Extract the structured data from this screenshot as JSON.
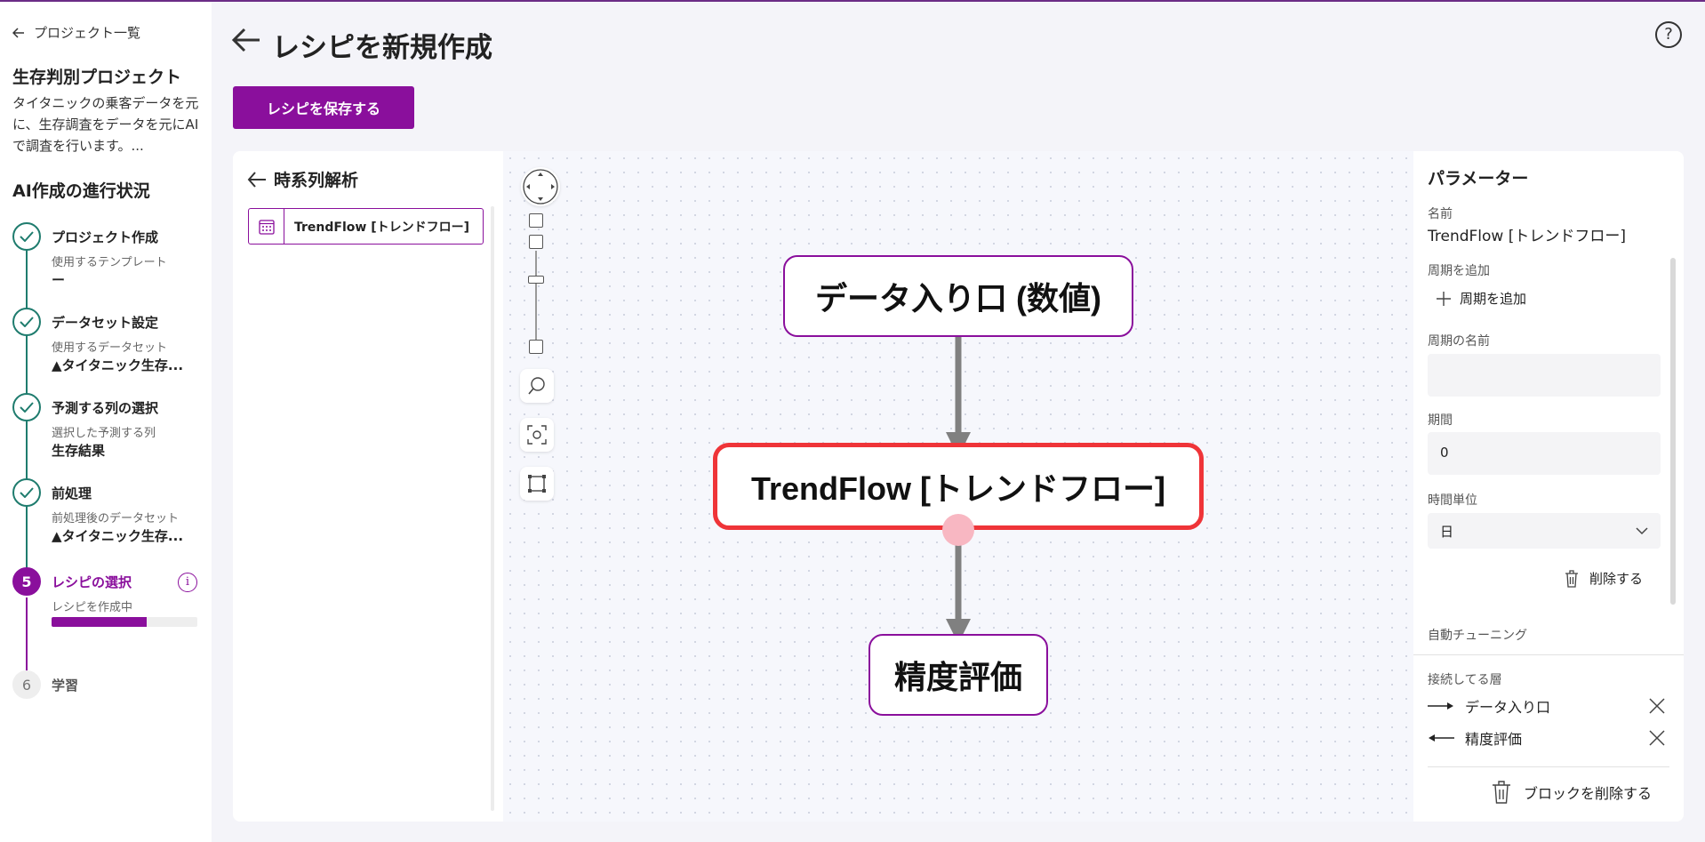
{
  "sidebar": {
    "back_label": "プロジェクト一覧",
    "project_title": "生存判別プロジェクト",
    "project_desc": "タイタニックの乗客データを元に、生存調査をデータを元にAIで調査を行います。...",
    "progress_title": "AI作成の進行状況",
    "steps": [
      {
        "name": "プロジェクト作成",
        "sub": "使用するテンプレート",
        "value": "ー",
        "status": "done"
      },
      {
        "name": "データセット設定",
        "sub": "使用するデータセット",
        "value": "▲タイタニック生存...",
        "status": "done"
      },
      {
        "name": "予測する列の選択",
        "sub": "選択した予測する列",
        "value": "生存結果",
        "status": "done"
      },
      {
        "name": "前処理",
        "sub": "前処理後のデータセット",
        "value": "▲タイタニック生存...",
        "status": "done"
      },
      {
        "num": "5",
        "name": "レシピの選択",
        "sub": "レシピを作成中",
        "status": "active",
        "progress": 0.65
      },
      {
        "num": "6",
        "name": "学習",
        "status": "todo"
      }
    ]
  },
  "header": {
    "title": "レシピを新規作成",
    "save_label": "レシピを保存する"
  },
  "block_list": {
    "category": "時系列解析",
    "items": [
      {
        "label": "TrendFlow [トレンドフロー]",
        "icon": "calendar-grid-icon"
      }
    ]
  },
  "canvas": {
    "nodes": [
      {
        "id": "input",
        "label": "データ入り口 (数値)"
      },
      {
        "id": "trendflow",
        "label": "TrendFlow [トレンドフロー]",
        "selected": true
      },
      {
        "id": "eval",
        "label": "精度評価"
      }
    ],
    "edges": [
      [
        "input",
        "trendflow"
      ],
      [
        "trendflow",
        "eval"
      ]
    ]
  },
  "params": {
    "title": "パラメーター",
    "name_label": "名前",
    "name_value": "TrendFlow [トレンドフロー]",
    "add_period_label": "周期を追加",
    "add_period_button": "周期を追加",
    "period_name_label": "周期の名前",
    "period_name_value": "",
    "duration_label": "期間",
    "duration_value": "0",
    "time_unit_label": "時間単位",
    "time_unit_value": "日",
    "delete_label": "削除する",
    "auto_tuning_label": "自動チューニング",
    "connected_label": "接続してる層",
    "connections": [
      {
        "direction": "out",
        "label": "データ入り口"
      },
      {
        "direction": "in",
        "label": "精度評価"
      }
    ],
    "delete_block_label": "ブロックを削除する"
  },
  "colors": {
    "accent": "#8a0f9c",
    "done": "#1f7c6e",
    "selected_node": "#ef3438",
    "handle": "#f8b7c2",
    "edge": "#808080"
  }
}
